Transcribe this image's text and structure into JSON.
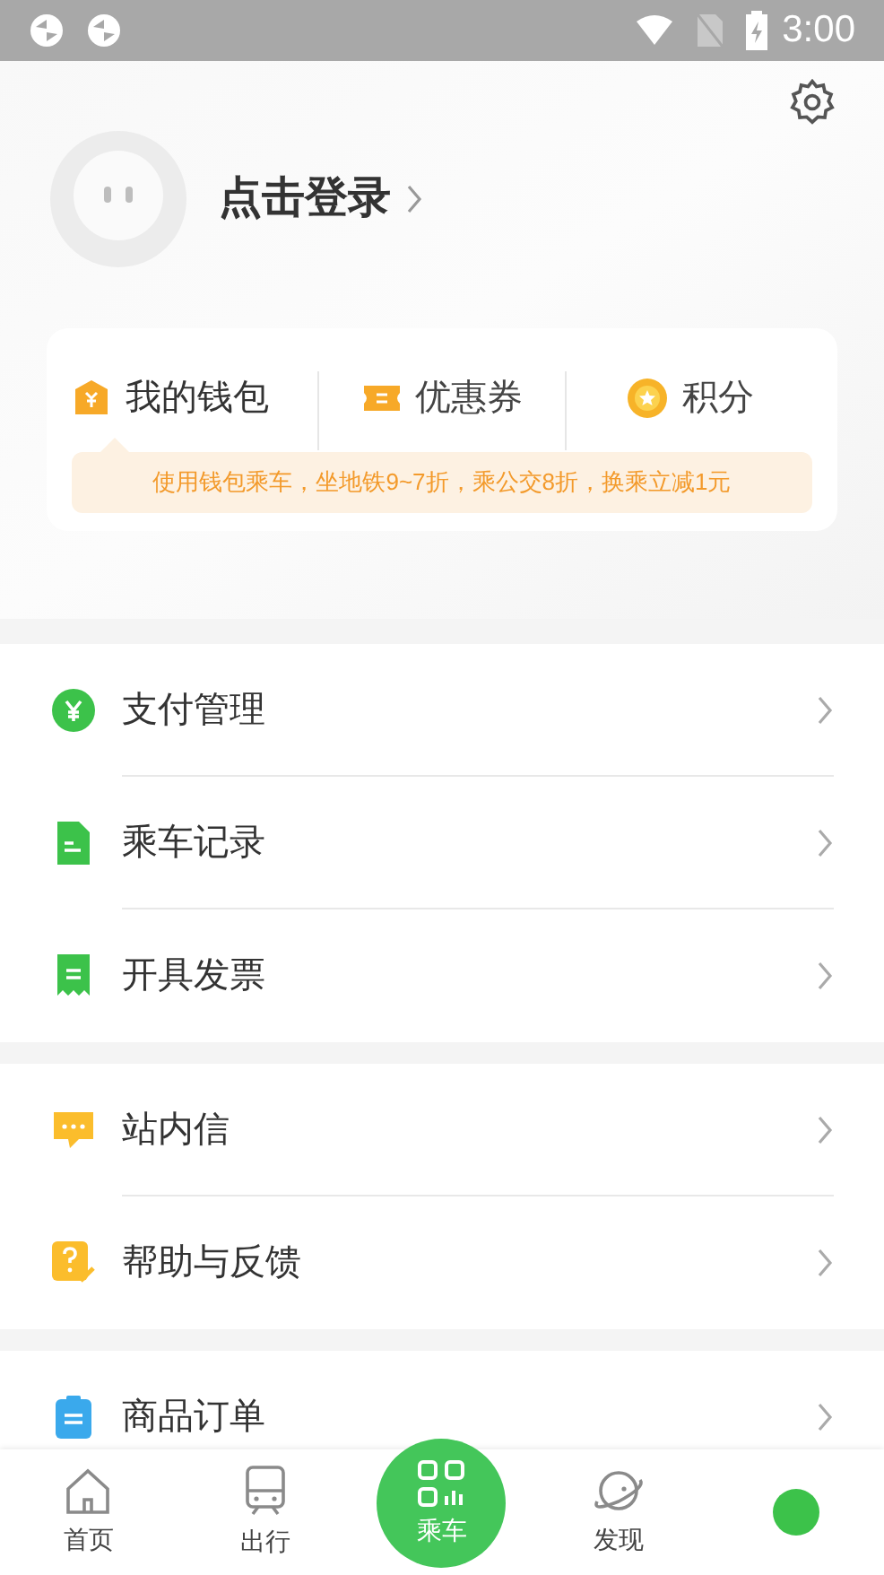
{
  "status_bar": {
    "time": "3:00"
  },
  "profile": {
    "login_label": "点击登录"
  },
  "wallet": {
    "items": [
      {
        "label": "我的钱包",
        "kind": "wallet",
        "selected": true
      },
      {
        "label": "优惠券",
        "kind": "coupon",
        "selected": false
      },
      {
        "label": "积分",
        "kind": "points",
        "selected": false
      }
    ],
    "promo": "使用钱包乘车，坐地铁9~7折，乘公交8折，换乘立减1元"
  },
  "menu_groups": [
    [
      {
        "label": "支付管理",
        "kind": "payment"
      },
      {
        "label": "乘车记录",
        "kind": "record"
      },
      {
        "label": "开具发票",
        "kind": "invoice"
      }
    ],
    [
      {
        "label": "站内信",
        "kind": "message"
      },
      {
        "label": "帮助与反馈",
        "kind": "help"
      }
    ],
    [
      {
        "label": "商品订单",
        "kind": "order"
      }
    ]
  ],
  "nav": [
    {
      "label": "首页",
      "kind": "home",
      "selected": false
    },
    {
      "label": "出行",
      "kind": "train",
      "selected": false
    },
    {
      "label": "乘车",
      "kind": "scan",
      "selected": false
    },
    {
      "label": "发现",
      "kind": "planet",
      "selected": false
    },
    {
      "kind": "profile",
      "selected": true
    }
  ]
}
